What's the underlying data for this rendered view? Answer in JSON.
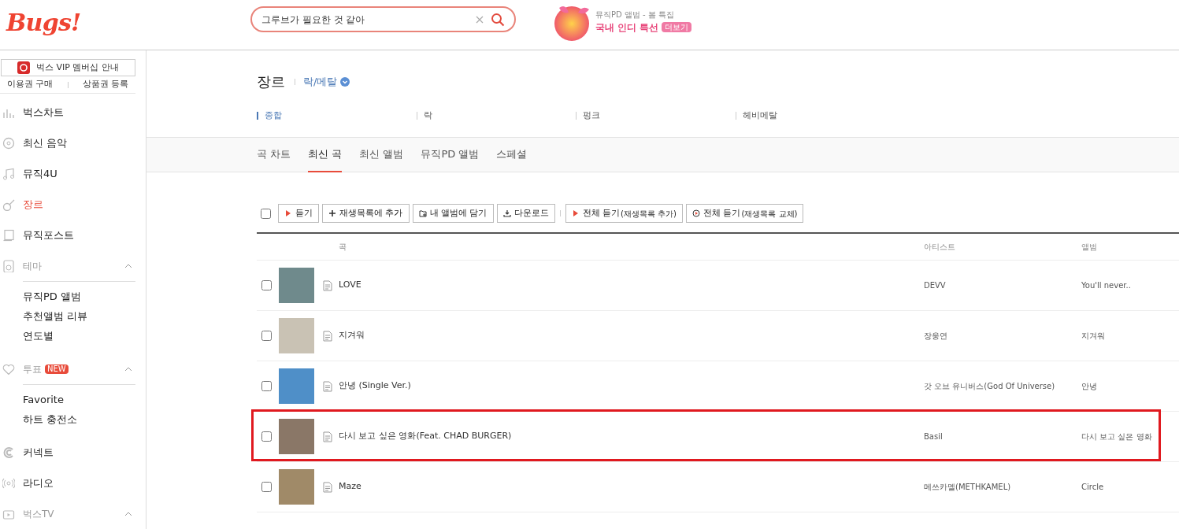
{
  "header": {
    "logo": "Bugs!",
    "search": {
      "value": "그루브가 필요한 것 같아"
    },
    "promo": {
      "caption": "뮤직PD 앨범 - 봄 특집",
      "title": "국내 인디 특선",
      "badge": "더보기"
    }
  },
  "sidebar": {
    "vip_button": "벅스 VIP 멤버십 안내",
    "links": [
      "이용권 구매",
      "상품권 등록"
    ],
    "items": [
      {
        "kind": "link",
        "label": "벅스차트",
        "selected": false
      },
      {
        "kind": "link",
        "label": "최신 음악",
        "selected": false
      },
      {
        "kind": "link",
        "label": "뮤직4U",
        "selected": false
      },
      {
        "kind": "link",
        "label": "장르",
        "selected": true
      },
      {
        "kind": "link",
        "label": "뮤직포스트",
        "selected": false
      },
      {
        "kind": "group",
        "label": "테마",
        "expanded": true,
        "children": [
          "뮤직PD 앨범",
          "추천앨범 리뷰",
          "연도별"
        ]
      },
      {
        "kind": "group",
        "label": "투표",
        "badge": "NEW",
        "expanded": true,
        "children": [
          "Favorite",
          "하트 충전소"
        ]
      },
      {
        "kind": "link",
        "label": "커넥트",
        "selected": false
      },
      {
        "kind": "link",
        "label": "라디오",
        "selected": false
      },
      {
        "kind": "group",
        "label": "벅스TV",
        "expanded": true
      }
    ]
  },
  "page": {
    "title": "장르",
    "genre": "락/메탈",
    "subgenres": [
      {
        "label": "종합",
        "selected": true
      },
      {
        "label": "락",
        "selected": false
      },
      {
        "label": "펑크",
        "selected": false
      },
      {
        "label": "헤비메탈",
        "selected": false
      }
    ],
    "tabs": [
      {
        "label": "곡 차트",
        "selected": false
      },
      {
        "label": "최신 곡",
        "selected": true
      },
      {
        "label": "최신 앨범",
        "selected": false
      },
      {
        "label": "뮤직PD 앨범",
        "selected": false
      },
      {
        "label": "스페셜",
        "selected": false
      }
    ]
  },
  "toolbar": {
    "select_all": {
      "checked": false
    },
    "buttons": [
      {
        "kind": "play",
        "label": "듣기"
      },
      {
        "kind": "add",
        "label": "재생목록에 추가"
      },
      {
        "kind": "album",
        "label": "내 앨범에 담기"
      },
      {
        "kind": "download",
        "label": "다운로드"
      },
      {
        "kind": "play",
        "label": "전체 듣기",
        "note": "(재생목록 추가)"
      },
      {
        "kind": "replace",
        "label": "전체 듣기",
        "note": "(재생목록 교체)"
      }
    ]
  },
  "table": {
    "columns": [
      "곡",
      "아티스트",
      "앨범"
    ],
    "rows": [
      {
        "checked": false,
        "title": "LOVE",
        "artist": "DEVV",
        "album": "You'll never..",
        "highlighted": false
      },
      {
        "checked": false,
        "title": "지겨워",
        "artist": "장웅연",
        "album": "지겨워",
        "highlighted": false
      },
      {
        "checked": false,
        "title": "안녕 (Single Ver.)",
        "artist": "갓 오브 유니버스(God Of Universe)",
        "album": "안녕",
        "highlighted": false
      },
      {
        "checked": false,
        "title": "다시 보고 싶은 영화(Feat. CHAD BURGER)",
        "artist": "Basil",
        "album": "다시 보고 싶은 영화",
        "highlighted": true
      },
      {
        "checked": false,
        "title": "Maze",
        "artist": "메쓰카멜(METHKAMEL)",
        "album": "Circle",
        "highlighted": false
      }
    ]
  }
}
